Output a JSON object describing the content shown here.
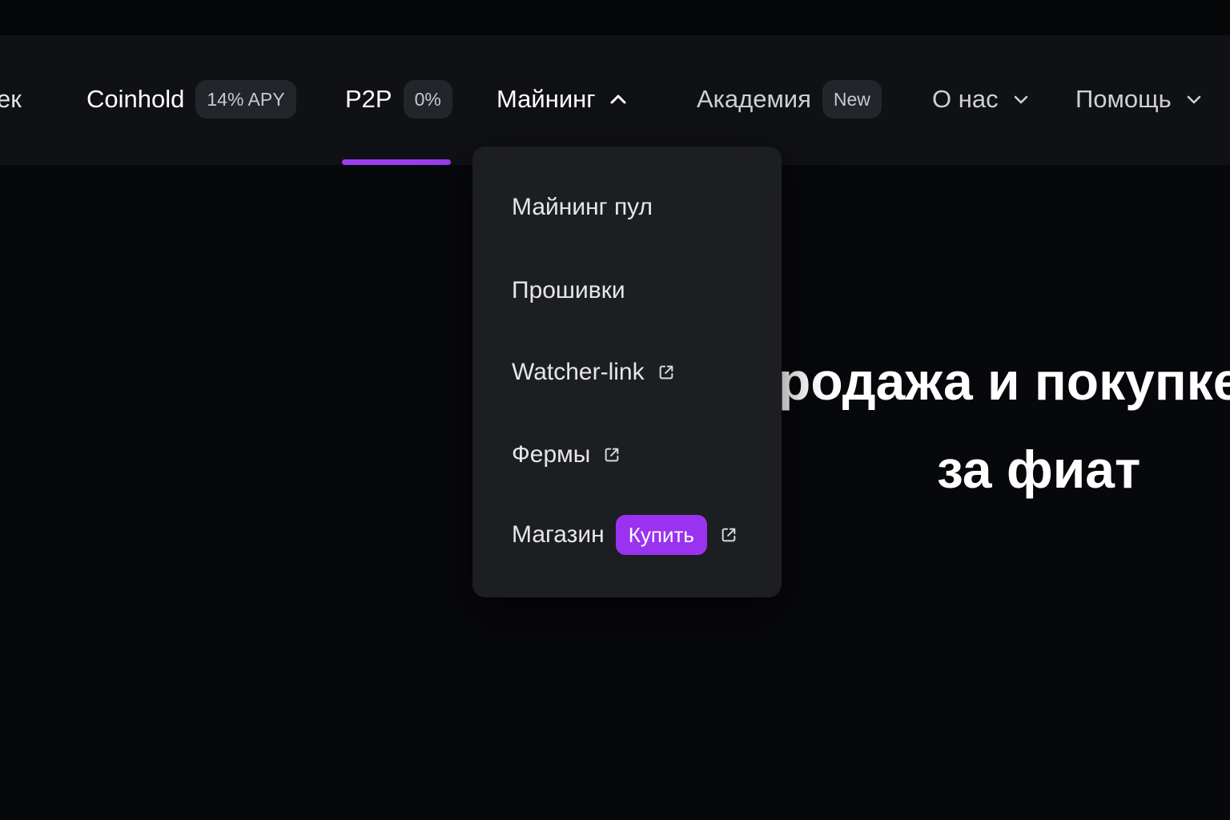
{
  "nav": {
    "partial_label": "ек",
    "coinhold": {
      "label": "Coinhold",
      "badge": "14% APY"
    },
    "p2p": {
      "label": "P2P",
      "badge": "0%"
    },
    "mining": {
      "label": "Майнинг"
    },
    "academy": {
      "label": "Академия",
      "badge": "New"
    },
    "about": {
      "label": "О нас"
    },
    "help": {
      "label": "Помощь"
    }
  },
  "mining_menu": {
    "items": [
      {
        "label": "Майнинг пул"
      },
      {
        "label": "Прошивки"
      },
      {
        "label": "Watcher-link",
        "icon": "external-link-icon"
      },
      {
        "label": "Фермы",
        "icon": "external-link-icon"
      },
      {
        "label": "Магазин",
        "pill": "Купить",
        "icon": "external-link-icon"
      }
    ]
  },
  "hero": {
    "line1": "родажа и покупке",
    "line2": "за фиат"
  },
  "colors": {
    "background": "#07080b",
    "navbar": "#101114",
    "accent": "#9a33f0",
    "dropdown": "#1d1e21"
  }
}
